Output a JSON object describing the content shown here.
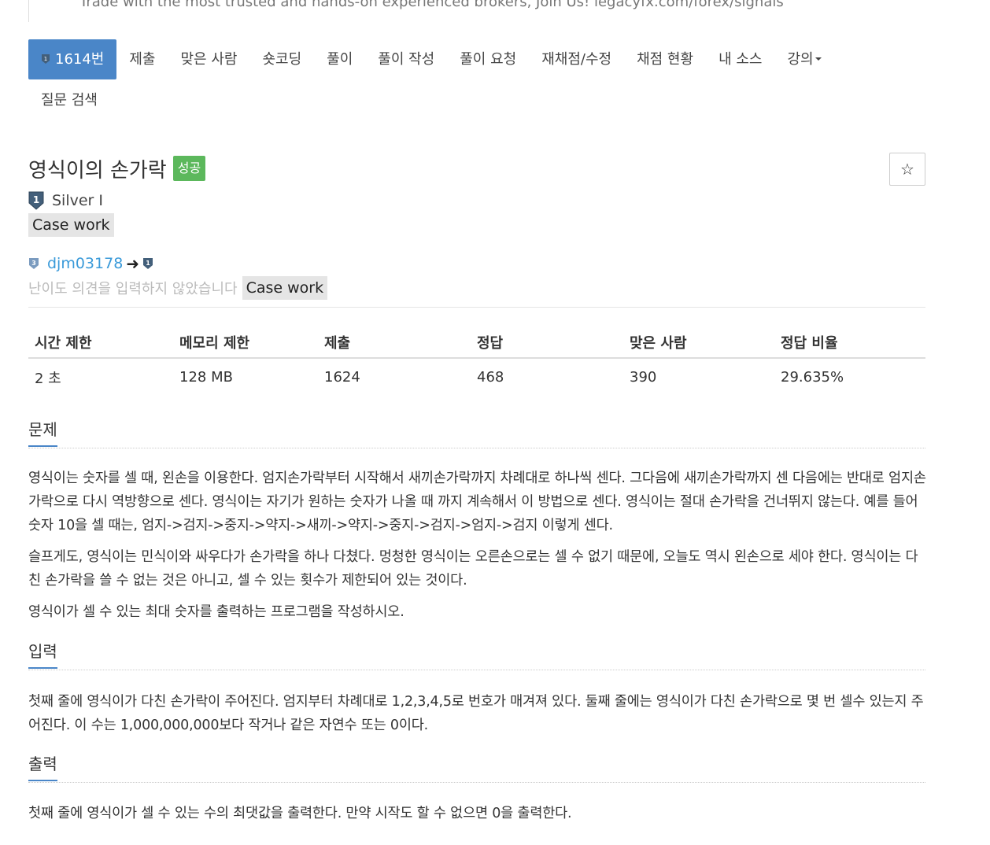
{
  "ad": {
    "text": "Trade with the most trusted and hands-on experienced brokers, Join Us! legacyfx.com/forex/signals"
  },
  "nav": {
    "items": [
      {
        "label": "1614번",
        "active": true,
        "icon": "tier-icon"
      },
      {
        "label": "제출"
      },
      {
        "label": "맞은 사람"
      },
      {
        "label": "숏코딩"
      },
      {
        "label": "풀이"
      },
      {
        "label": "풀이 작성"
      },
      {
        "label": "풀이 요청"
      },
      {
        "label": "재채점/수정"
      },
      {
        "label": "채점 현황"
      },
      {
        "label": "내 소스"
      },
      {
        "label": "강의"
      }
    ],
    "second_row": [
      {
        "label": "질문 검색"
      }
    ]
  },
  "problem": {
    "title": "영식이의 손가락",
    "status_badge": "성공",
    "star_icon": "☆",
    "tier": "Silver I",
    "tag": "Case work",
    "contributor": {
      "name": "djm03178",
      "arrow": "➜"
    },
    "opinion": {
      "text": "난이도 의견을 입력하지 않았습니다",
      "tag": "Case work"
    }
  },
  "info_table": {
    "headers": [
      "시간 제한",
      "메모리 제한",
      "제출",
      "정답",
      "맞은 사람",
      "정답 비율"
    ],
    "values": [
      "2 초",
      "128 MB",
      "1624",
      "468",
      "390",
      "29.635%"
    ]
  },
  "sections": {
    "problem": {
      "title": "문제",
      "paragraphs": [
        "영식이는 숫자를 셀 때, 왼손을 이용한다. 엄지손가락부터 시작해서 새끼손가락까지 차례대로 하나씩 센다. 그다음에 새끼손가락까지 센 다음에는 반대로 엄지손가락으로 다시 역방향으로 센다. 영식이는 자기가 원하는 숫자가 나올 때 까지 계속해서 이 방법으로 센다. 영식이는 절대 손가락을 건너뛰지 않는다. 예를 들어 숫자 10을 셀 때는, 엄지->검지->중지->약지->새끼->약지->중지->검지->엄지->검지 이렇게 센다.",
        "슬프게도, 영식이는 민식이와 싸우다가 손가락을 하나 다쳤다. 멍청한 영식이는 오른손으로는 셀 수 없기 때문에, 오늘도 역시 왼손으로 세야 한다. 영식이는 다친 손가락을 쓸 수 없는 것은 아니고, 셀 수 있는 횟수가 제한되어 있는 것이다.",
        "영식이가 셀 수 있는 최대 숫자를 출력하는 프로그램을 작성하시오."
      ]
    },
    "input": {
      "title": "입력",
      "paragraphs": [
        "첫째 줄에 영식이가 다친 손가락이 주어진다. 엄지부터 차례대로 1,2,3,4,5로 번호가 매겨져 있다. 둘째 줄에는 영식이가 다친 손가락으로 몇 번 셀수 있는지 주어진다. 이 수는 1,000,000,000보다 작거나 같은 자연수 또는 0이다."
      ]
    },
    "output": {
      "title": "출력",
      "paragraphs": [
        "첫째 줄에 영식이가 셀 수 있는 수의 최댓값을 출력한다. 만약 시작도 할 수 없으면 0을 출력한다."
      ]
    }
  },
  "colors": {
    "accent": "#4a86c8",
    "success": "#5cb85c",
    "link": "#3a9ad9",
    "tier_silver": "#435f7a",
    "tier_gold": "#7a9bbf"
  }
}
